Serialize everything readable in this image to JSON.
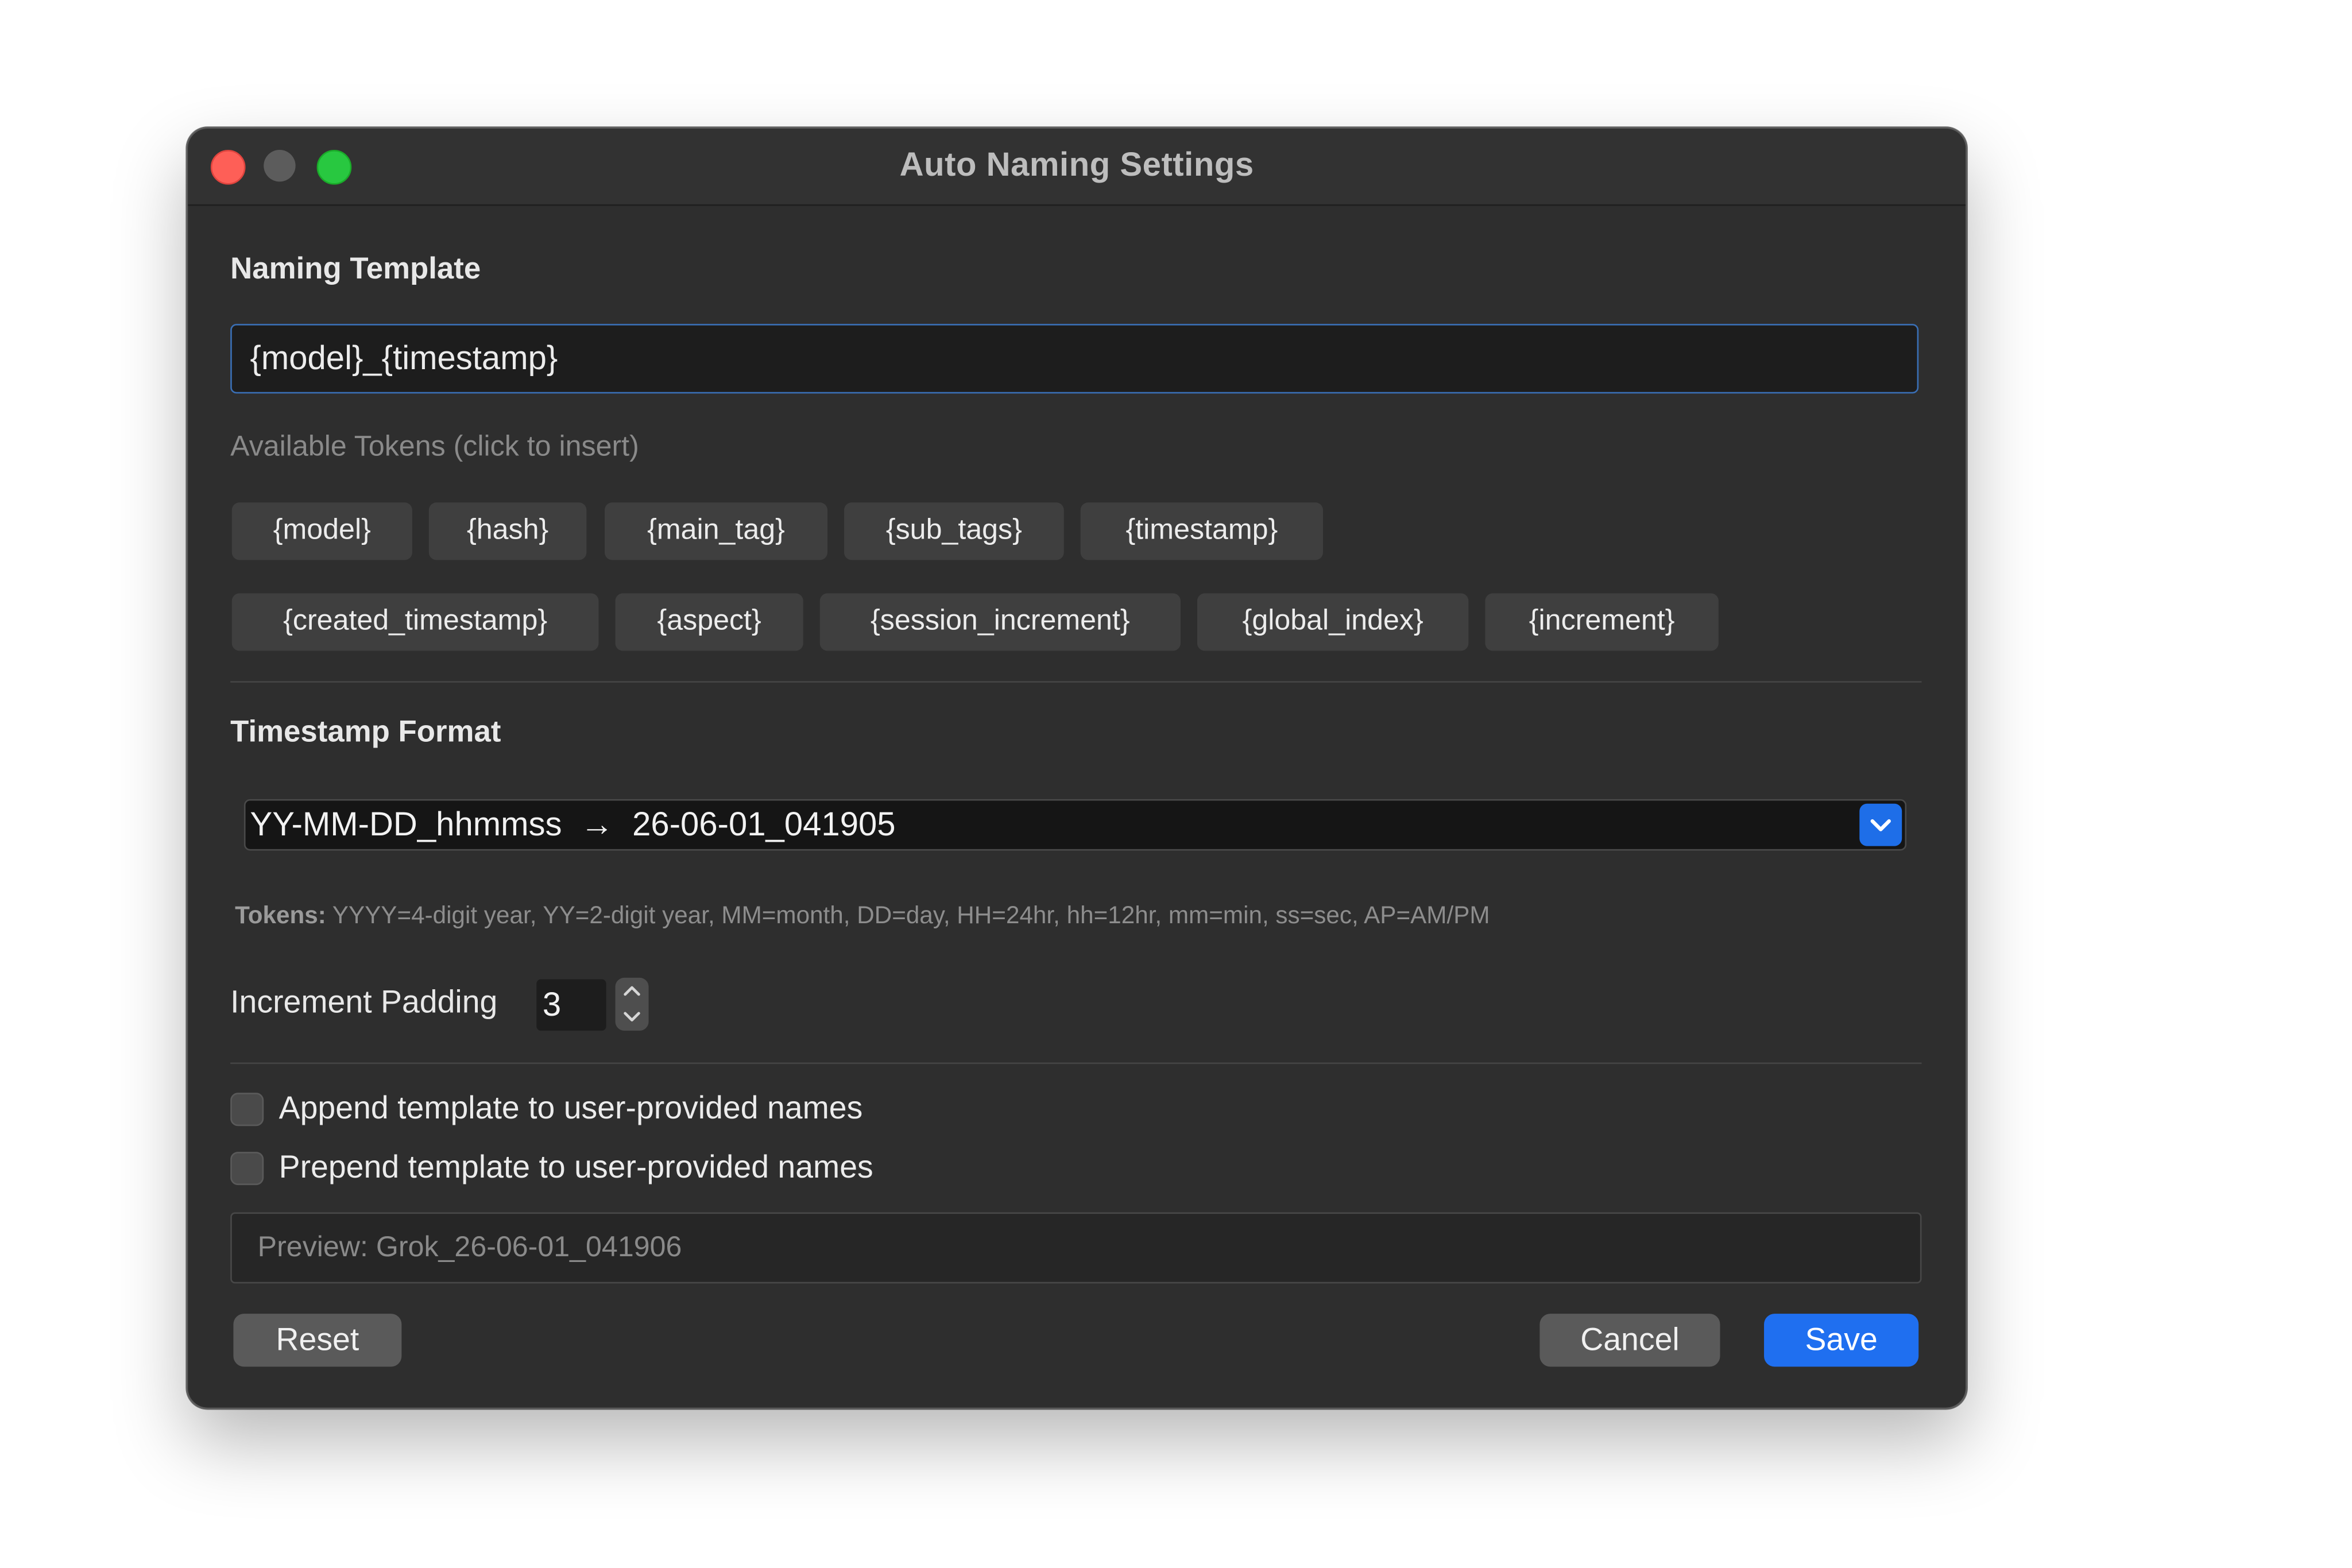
{
  "window": {
    "title": "Auto Naming Settings"
  },
  "naming_template": {
    "section_title": "Naming Template",
    "value": "{model}_{timestamp}",
    "tokens_hint": "Available Tokens  (click to insert)",
    "tokens": [
      "{model}",
      "{hash}",
      "{main_tag}",
      "{sub_tags}",
      "{timestamp}",
      "{created_timestamp}",
      "{aspect}",
      "{session_increment}",
      "{global_index}",
      "{increment}"
    ]
  },
  "timestamp_format": {
    "section_title": "Timestamp Format",
    "selected": "YY-MM-DD_hhmmss  →  26-06-01_041905",
    "tokens_note_label": "Tokens:",
    "tokens_note_text": " YYYY=4-digit year, YY=2-digit year, MM=month, DD=day, HH=24hr, hh=12hr, mm=min, ss=sec, AP=AM/PM"
  },
  "increment_padding": {
    "label": "Increment Padding",
    "value": "3"
  },
  "options": {
    "append_label": "Append template to user-provided names",
    "append_checked": false,
    "prepend_label": "Prepend template to user-provided names",
    "prepend_checked": false
  },
  "preview": {
    "text": "Preview:  Grok_26-06-01_041906"
  },
  "buttons": {
    "reset": "Reset",
    "cancel": "Cancel",
    "save": "Save"
  },
  "colors": {
    "window_bg": "#2e2e2e",
    "accent": "#1f6ff0",
    "close": "#fe5f57",
    "zoom": "#28c840"
  },
  "icons": {
    "traffic_close": "close-icon",
    "traffic_minimize": "minimize-icon",
    "traffic_zoom": "zoom-icon",
    "select_toggle": "chevron-down-icon",
    "stepper_up": "chevron-up-icon",
    "stepper_down": "chevron-down-icon"
  }
}
